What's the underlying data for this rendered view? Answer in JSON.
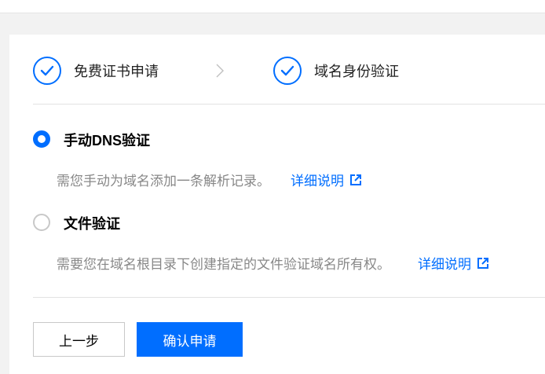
{
  "steps": [
    {
      "label": "免费证书申请",
      "done": true
    },
    {
      "label": "域名身份验证",
      "done": true
    }
  ],
  "options": [
    {
      "title": "手动DNS验证",
      "checked": true,
      "description": "需您手动为域名添加一条解析记录。",
      "link_label": "详细说明"
    },
    {
      "title": "文件验证",
      "checked": false,
      "description": "需要您在域名根目录下创建指定的文件验证域名所有权。",
      "link_label": "详细说明"
    }
  ],
  "buttons": {
    "prev_label": "上一步",
    "confirm_label": "确认申请"
  },
  "colors": {
    "accent": "#006eff",
    "muted_text": "#888888"
  }
}
